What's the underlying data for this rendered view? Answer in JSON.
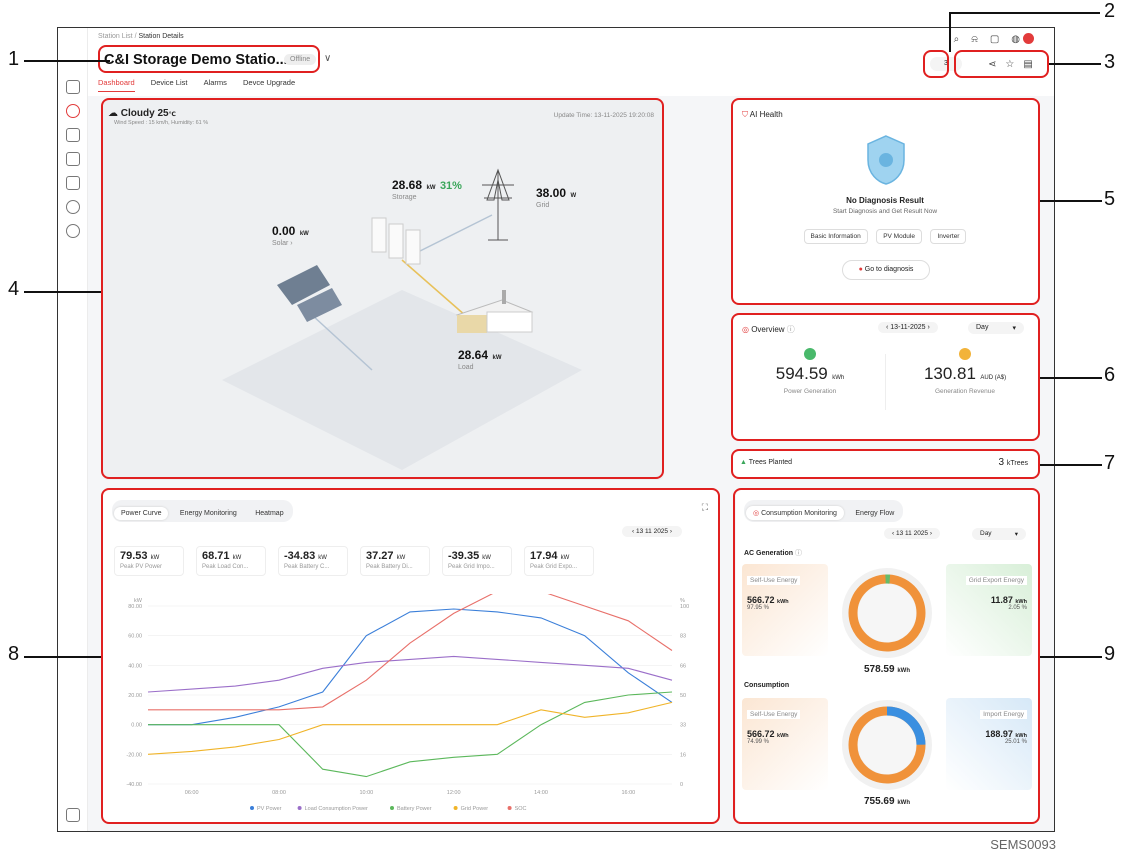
{
  "breadcrumb": {
    "parent": "Station List",
    "current": "Station Details"
  },
  "station": {
    "title": "C&I Storage Demo Statio...",
    "status": "Offline"
  },
  "tabs": [
    "Dashboard",
    "Device List",
    "Alarms",
    "Devce Upgrade"
  ],
  "selector_count": "3",
  "weather": {
    "condition": "Cloudy",
    "temp": "25",
    "temp_unit": "℃",
    "details": "Wind Speed : 15 km/h, Humidity: 61 %",
    "update_time": "Update Time: 13-11-2025 19:20:08"
  },
  "flow": {
    "storage": {
      "value": "28.68",
      "unit": "kW",
      "percent": "31%",
      "label": "Storage"
    },
    "grid": {
      "value": "38.00",
      "unit": "W",
      "label": "Grid"
    },
    "solar": {
      "value": "0.00",
      "unit": "kW",
      "label": "Solar ›"
    },
    "load": {
      "value": "28.64",
      "unit": "kW",
      "label": "Load"
    }
  },
  "ai_health": {
    "title": "AI Health",
    "result": "No Diagnosis Result",
    "sub": "Start Diagnosis and Get Result Now",
    "chips": [
      "Basic Information",
      "PV Module",
      "Inverter"
    ],
    "button": "Go to diagnosis"
  },
  "overview": {
    "title": "Overview",
    "date": "13-11-2025",
    "period": "Day",
    "gen_value": "594.59",
    "gen_unit": "kWh",
    "gen_label": "Power Generation",
    "rev_value": "130.81",
    "rev_unit": "AUD (A$)",
    "rev_label": "Generation Revenue"
  },
  "trees": {
    "label": "Trees Planted",
    "value": "3",
    "unit": "kTrees"
  },
  "power": {
    "tabs": [
      "Power Curve",
      "Energy Monitoring",
      "Heatmap"
    ],
    "date": "13 11 2025",
    "stats": [
      {
        "v": "79.53",
        "u": "kW",
        "k": "Peak PV Power"
      },
      {
        "v": "68.71",
        "u": "kW",
        "k": "Peak Load Con..."
      },
      {
        "v": "-34.83",
        "u": "kW",
        "k": "Peak Battery C..."
      },
      {
        "v": "37.27",
        "u": "kW",
        "k": "Peak Battery Di..."
      },
      {
        "v": "-39.35",
        "u": "kW",
        "k": "Peak Grid Impo..."
      },
      {
        "v": "17.94",
        "u": "kW",
        "k": "Peak Grid Expo..."
      }
    ]
  },
  "consumption": {
    "tabs": [
      "Consumption Monitoring",
      "Energy Flow"
    ],
    "date": "13 11 2025",
    "period": "Day",
    "ac_title": "AC Generation",
    "self_use_label": "Self-Use Energy",
    "self_use_value": "566.72",
    "self_use_unit": "kWh",
    "self_use_pct": "97.95 %",
    "export_label": "Grid Export Energy",
    "export_value": "11.87",
    "export_unit": "kWh",
    "export_pct": "2.05 %",
    "ac_total": "578.59",
    "total_unit": "kWh",
    "cons_title": "Consumption",
    "c_self_label": "Self-Use Energy",
    "c_self_value": "566.72",
    "c_self_unit": "kWh",
    "c_self_pct": "74.99 %",
    "import_label": "Import Energy",
    "import_value": "188.97",
    "import_unit": "kWh",
    "import_pct": "25.01 %",
    "cons_total": "755.69"
  },
  "callouts": [
    "1",
    "2",
    "3",
    "4",
    "5",
    "6",
    "7",
    "8",
    "9"
  ],
  "figure_id": "SEMS0093",
  "chart_data": {
    "type": "line",
    "x_ticks": [
      "06:00",
      "08:00",
      "10:00",
      "12:00",
      "14:00",
      "16:00"
    ],
    "ylabel_left": "kW",
    "ylabel_right": "%",
    "y_left_ticks": [
      "80.00",
      "60.00",
      "40.00",
      "20.00",
      "0.00",
      "-20.00",
      "-40.00"
    ],
    "y_right_ticks": [
      "100",
      "83",
      "66",
      "50",
      "33",
      "16",
      "0"
    ],
    "ylim": [
      -40,
      80
    ],
    "series": [
      {
        "name": "PV Power",
        "color": "#3b7fd9",
        "x": [
          5,
          6,
          7,
          8,
          9,
          10,
          11,
          12,
          13,
          14,
          15,
          16,
          17
        ],
        "values": [
          0,
          0,
          5,
          12,
          22,
          60,
          76,
          78,
          76,
          72,
          60,
          35,
          15
        ]
      },
      {
        "name": "Load Consumption Power",
        "color": "#9b6fc9",
        "x": [
          5,
          6,
          7,
          8,
          9,
          10,
          11,
          12,
          13,
          14,
          15,
          16,
          17
        ],
        "values": [
          22,
          24,
          26,
          30,
          38,
          42,
          44,
          46,
          44,
          42,
          40,
          38,
          30
        ]
      },
      {
        "name": "Battery Power",
        "color": "#5cb85c",
        "x": [
          5,
          6,
          7,
          8,
          9,
          10,
          11,
          12,
          13,
          14,
          15,
          16,
          17
        ],
        "values": [
          0,
          0,
          0,
          0,
          -30,
          -35,
          -25,
          -22,
          -20,
          0,
          15,
          20,
          22
        ]
      },
      {
        "name": "Grid Power",
        "color": "#f0b429",
        "x": [
          5,
          6,
          7,
          8,
          9,
          10,
          11,
          12,
          13,
          14,
          15,
          16,
          17
        ],
        "values": [
          -20,
          -18,
          -15,
          -10,
          0,
          0,
          0,
          0,
          0,
          10,
          5,
          8,
          15
        ]
      },
      {
        "name": "SOC",
        "color": "#e8706a",
        "x": [
          5,
          6,
          7,
          8,
          9,
          10,
          11,
          12,
          13,
          14,
          15,
          16,
          17
        ],
        "values": [
          10,
          10,
          10,
          10,
          12,
          30,
          55,
          75,
          90,
          90,
          80,
          70,
          50
        ]
      }
    ]
  }
}
